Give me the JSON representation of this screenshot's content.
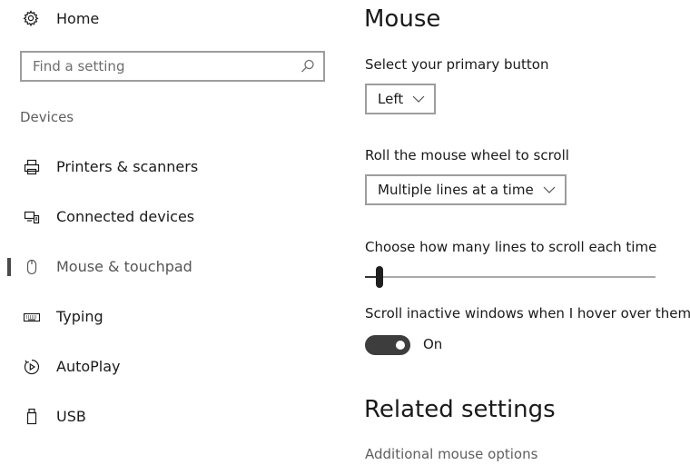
{
  "sidebar": {
    "home_label": "Home",
    "search_placeholder": "Find a setting",
    "category": "Devices",
    "items": [
      {
        "label": "Printers & scanners",
        "icon": "printer-icon"
      },
      {
        "label": "Connected devices",
        "icon": "connected-devices-icon"
      },
      {
        "label": "Mouse & touchpad",
        "icon": "mouse-icon",
        "selected": true
      },
      {
        "label": "Typing",
        "icon": "keyboard-icon"
      },
      {
        "label": "AutoPlay",
        "icon": "autoplay-icon"
      },
      {
        "label": "USB",
        "icon": "usb-icon"
      }
    ]
  },
  "main": {
    "title": "Mouse",
    "primary_button": {
      "label": "Select your primary button",
      "value": "Left"
    },
    "wheel_scroll": {
      "label": "Roll the mouse wheel to scroll",
      "value": "Multiple lines at a time"
    },
    "lines_to_scroll": {
      "label": "Choose how many lines to scroll each time",
      "fraction": 0.03
    },
    "inactive_scroll": {
      "label": "Scroll inactive windows when I hover over them",
      "state_label": "On",
      "enabled": true
    },
    "related_title": "Related settings",
    "related_links": [
      "Additional mouse options"
    ]
  },
  "colors": {
    "toggle_on": "#3d3d3d",
    "selection_indicator": "#4a4a4a",
    "secondary_text": "#5f5f5f"
  }
}
